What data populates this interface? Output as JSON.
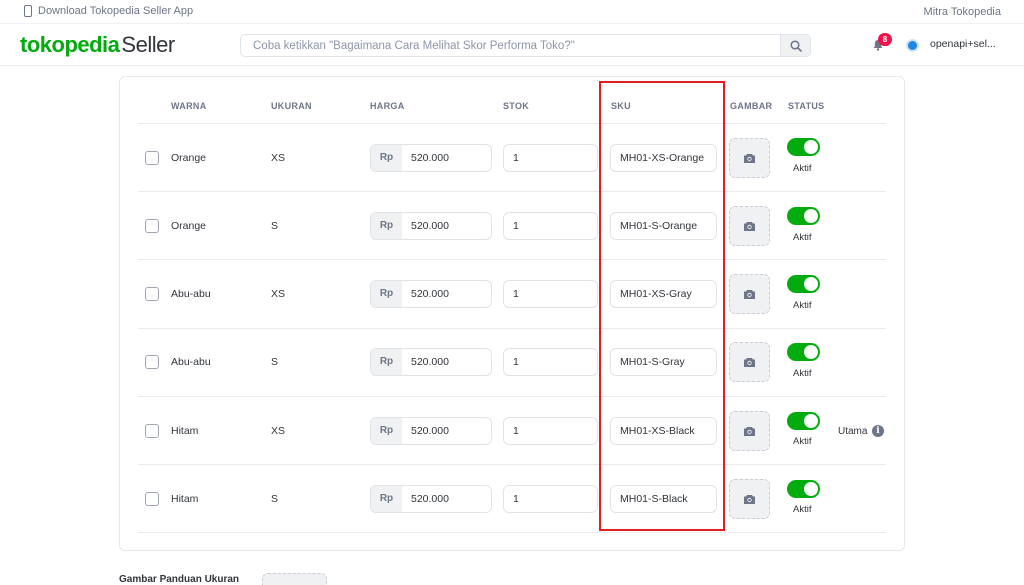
{
  "topstrip": {
    "download_label": "Download Tokopedia Seller App",
    "mitra_label": "Mitra Tokopedia"
  },
  "header": {
    "logo_brand": "tokopedia",
    "logo_seller": "Seller",
    "search_placeholder": "Coba ketikkan \"Bagaimana Cara Melihat Skor Performa Toko?\"",
    "notification_count": "8",
    "username": "openapi+sel..."
  },
  "table": {
    "columns": {
      "warna": "WARNA",
      "ukuran": "UKURAN",
      "harga": "HARGA",
      "stok": "STOK",
      "sku": "SKU",
      "gambar": "GAMBAR",
      "status": "STATUS"
    },
    "currency": "Rp",
    "rows": [
      {
        "warna": "Orange",
        "ukuran": "XS",
        "harga": "520.000",
        "stok": "1",
        "sku": "MH01-XS-Orange",
        "status": "Aktif"
      },
      {
        "warna": "Orange",
        "ukuran": "S",
        "harga": "520.000",
        "stok": "1",
        "sku": "MH01-S-Orange",
        "status": "Aktif"
      },
      {
        "warna": "Abu-abu",
        "ukuran": "XS",
        "harga": "520.000",
        "stok": "1",
        "sku": "MH01-XS-Gray",
        "status": "Aktif"
      },
      {
        "warna": "Abu-abu",
        "ukuran": "S",
        "harga": "520.000",
        "stok": "1",
        "sku": "MH01-S-Gray",
        "status": "Aktif"
      },
      {
        "warna": "Hitam",
        "ukuran": "XS",
        "harga": "520.000",
        "stok": "1",
        "sku": "MH01-XS-Black",
        "status": "Aktif"
      },
      {
        "warna": "Hitam",
        "ukuran": "S",
        "harga": "520.000",
        "stok": "1",
        "sku": "MH01-S-Black",
        "status": "Aktif"
      }
    ],
    "primary_label": "Utama"
  },
  "footer": {
    "size_guide_title": "Gambar Panduan Ukuran"
  },
  "colors": {
    "brand_green": "#03ac0e",
    "highlight_red": "#e02020",
    "badge_red": "#ef144a"
  }
}
